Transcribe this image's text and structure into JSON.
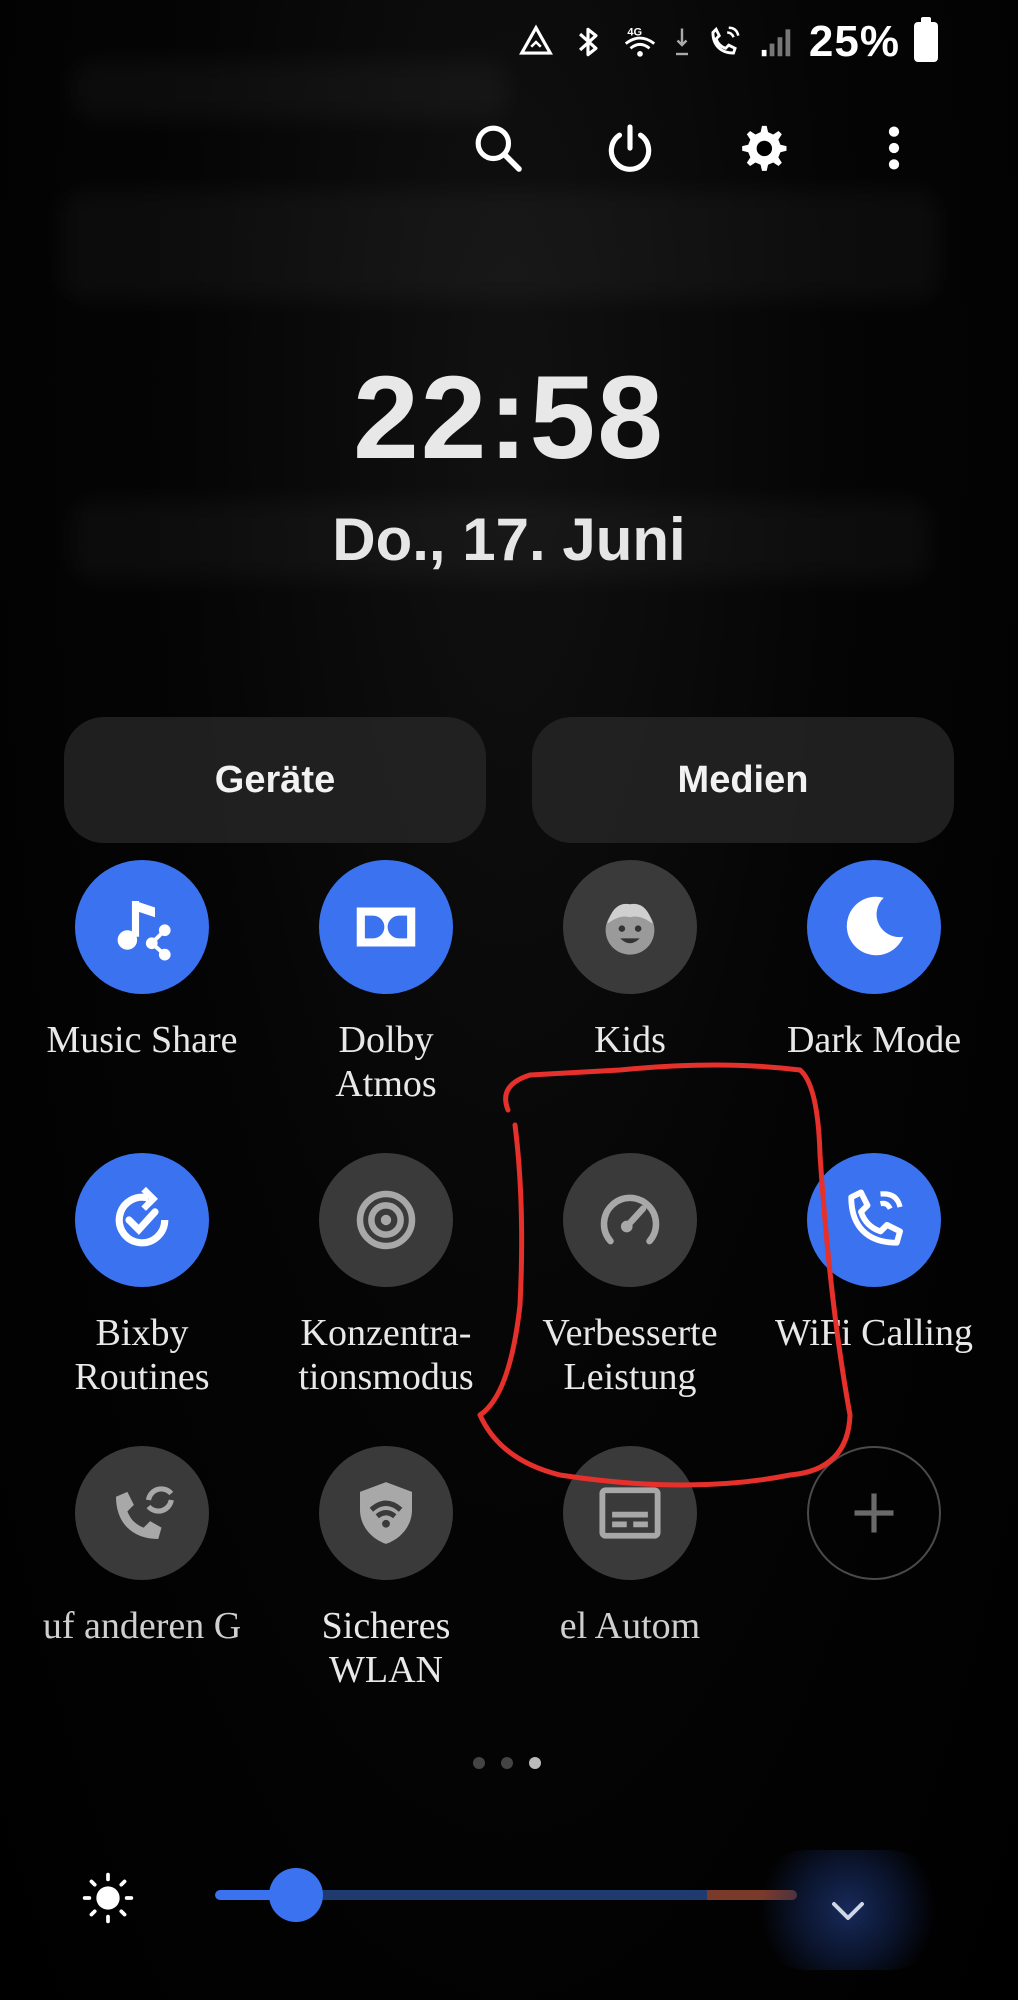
{
  "status_bar": {
    "icons": [
      "data-saver-icon",
      "bluetooth-icon",
      "wifi-4g-icon",
      "data-arrows-icon",
      "wifi-calling-icon",
      "signal-bars-icon"
    ],
    "network_label": "4G",
    "battery_percent": "25%"
  },
  "actions": {
    "icons": [
      "search-icon",
      "power-icon",
      "settings-icon",
      "more-options-icon"
    ]
  },
  "clock": {
    "time": "22:58",
    "date": "Do., 17. Juni"
  },
  "pills": {
    "devices": "Geräte",
    "media": "Medien"
  },
  "tiles": [
    {
      "label": "Music Share",
      "icon": "music-share-icon",
      "state": "on"
    },
    {
      "label": "Dolby\nAtmos",
      "icon": "dolby-icon",
      "state": "on"
    },
    {
      "label": "Kids",
      "icon": "kids-icon",
      "state": "off"
    },
    {
      "label": "Dark Mode",
      "icon": "moon-icon",
      "state": "on"
    },
    {
      "label": "Bixby\nRoutines",
      "icon": "bixby-routines-icon",
      "state": "on"
    },
    {
      "label": "Konzentra-\ntionsmodus",
      "icon": "focus-target-icon",
      "state": "off"
    },
    {
      "label": "Verbesserte\nLeistung",
      "icon": "speedometer-icon",
      "state": "off"
    },
    {
      "label": "WiFi Calling",
      "icon": "wifi-calling-icon",
      "state": "on"
    },
    {
      "label": "uf anderen G",
      "icon": "call-forward-icon",
      "state": "off"
    },
    {
      "label": "Sicheres\nWLAN",
      "icon": "secure-wifi-icon",
      "state": "off"
    },
    {
      "label": "el    Autom",
      "icon": "caption-icon",
      "state": "off"
    },
    {
      "label": "",
      "icon": "add-icon",
      "state": "outline"
    }
  ],
  "pager": {
    "pages": 3,
    "active": 3
  },
  "brightness": {
    "level_fraction": 0.14,
    "icon": "brightness-sun-icon"
  },
  "colors": {
    "accent": "#3b72f0",
    "tile_off": "#3a3a3a",
    "annotation": "#e5302b"
  }
}
